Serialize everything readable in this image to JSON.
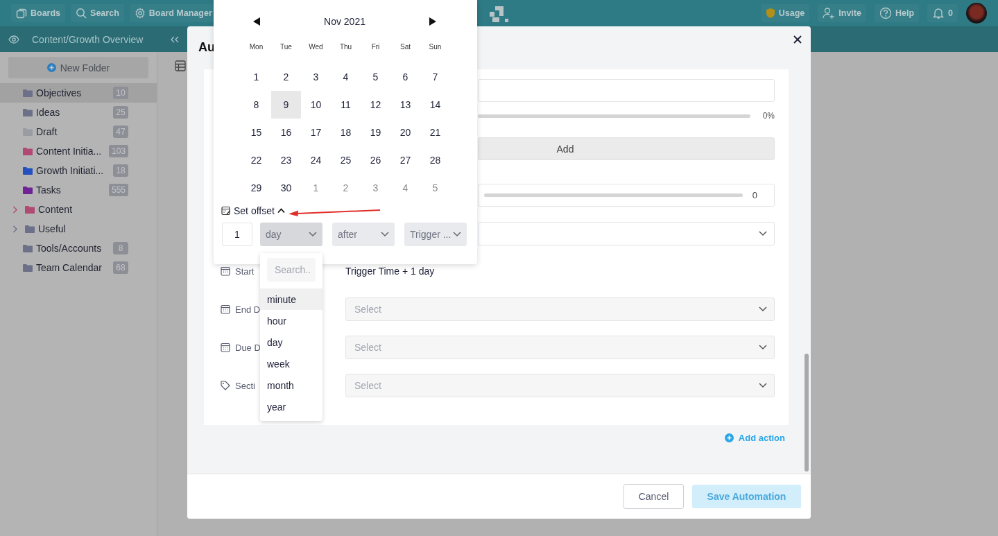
{
  "topbar": {
    "buttons": [
      {
        "kind": "boards",
        "label": "Boards"
      },
      {
        "kind": "search",
        "label": "Search"
      },
      {
        "kind": "settings",
        "label": "Board Manager"
      }
    ],
    "right": [
      {
        "kind": "usage",
        "label": "Usage"
      },
      {
        "kind": "invite",
        "label": "Invite"
      },
      {
        "kind": "help",
        "label": "Help"
      },
      {
        "kind": "notifications",
        "label": "0"
      }
    ]
  },
  "board_bar": {
    "title": "Content/Growth Overview"
  },
  "sidebar": {
    "new_folder": "New Folder",
    "items": [
      {
        "label": "Objectives",
        "count": "10",
        "color": "#6c7088",
        "selected": true,
        "expandable": false
      },
      {
        "label": "Ideas",
        "count": "25",
        "color": "#6c7088",
        "selected": false,
        "expandable": false
      },
      {
        "label": "Draft",
        "count": "47",
        "color": "#9a9ca4",
        "selected": false,
        "expandable": false
      },
      {
        "label": "Content Initia...",
        "count": "103",
        "color": "#b04a72",
        "selected": false,
        "expandable": false
      },
      {
        "label": "Growth Initiati...",
        "count": "18",
        "color": "#2450c0",
        "selected": false,
        "expandable": false
      },
      {
        "label": "Tasks",
        "count": "555",
        "color": "#6e2494",
        "selected": false,
        "expandable": false
      },
      {
        "label": "Content",
        "color": "#b04a72",
        "selected": false,
        "expandable": true,
        "expanded": false
      },
      {
        "label": "Useful",
        "color": "#6c7088",
        "selected": false,
        "expandable": true,
        "expanded": false
      },
      {
        "label": "Tools/Accounts",
        "count": "8",
        "color": "#6c7088",
        "selected": false,
        "expandable": false
      },
      {
        "label": "Team Calendar",
        "count": "68",
        "color": "#6c7088",
        "selected": false,
        "expandable": false
      }
    ]
  },
  "modal": {
    "title": "Au",
    "progress": {
      "level": 0,
      "reading": "0%"
    },
    "add_button": "Add",
    "slider": {
      "reading": "0"
    },
    "fields": [
      {
        "kind": "date_value",
        "label": "Start",
        "value": "Trigger Time + 1 day"
      },
      {
        "kind": "date_select",
        "label": "End D",
        "placeholder": "Select"
      },
      {
        "kind": "date_select",
        "label": "Due D",
        "placeholder": "Select"
      },
      {
        "kind": "tag_select",
        "label": "Secti",
        "placeholder": "Select"
      }
    ],
    "add_action": "Add action",
    "cancel": "Cancel",
    "save": {
      "label": "Save Automation",
      "disabled": true
    }
  },
  "calendar": {
    "month": "Nov 2021",
    "weekdays": [
      "Mon",
      "Tue",
      "Wed",
      "Thu",
      "Fri",
      "Sat",
      "Sun"
    ],
    "days": [
      {
        "label": "1",
        "outside": false,
        "selected": false
      },
      {
        "label": "2",
        "outside": false,
        "selected": false
      },
      {
        "label": "3",
        "outside": false,
        "selected": false
      },
      {
        "label": "4",
        "outside": false,
        "selected": false
      },
      {
        "label": "5",
        "outside": false,
        "selected": false
      },
      {
        "label": "6",
        "outside": false,
        "selected": false
      },
      {
        "label": "7",
        "outside": false,
        "selected": false
      },
      {
        "label": "8",
        "outside": false,
        "selected": false
      },
      {
        "label": "9",
        "outside": false,
        "selected": true
      },
      {
        "label": "10",
        "outside": false,
        "selected": false
      },
      {
        "label": "11",
        "outside": false,
        "selected": false
      },
      {
        "label": "12",
        "outside": false,
        "selected": false
      },
      {
        "label": "13",
        "outside": false,
        "selected": false
      },
      {
        "label": "14",
        "outside": false,
        "selected": false
      },
      {
        "label": "15",
        "outside": false,
        "selected": false
      },
      {
        "label": "16",
        "outside": false,
        "selected": false
      },
      {
        "label": "17",
        "outside": false,
        "selected": false
      },
      {
        "label": "18",
        "outside": false,
        "selected": false
      },
      {
        "label": "19",
        "outside": false,
        "selected": false
      },
      {
        "label": "20",
        "outside": false,
        "selected": false
      },
      {
        "label": "21",
        "outside": false,
        "selected": false
      },
      {
        "label": "22",
        "outside": false,
        "selected": false
      },
      {
        "label": "23",
        "outside": false,
        "selected": false
      },
      {
        "label": "24",
        "outside": false,
        "selected": false
      },
      {
        "label": "25",
        "outside": false,
        "selected": false
      },
      {
        "label": "26",
        "outside": false,
        "selected": false
      },
      {
        "label": "27",
        "outside": false,
        "selected": false
      },
      {
        "label": "28",
        "outside": false,
        "selected": false
      },
      {
        "label": "29",
        "outside": false,
        "selected": false
      },
      {
        "label": "30",
        "outside": false,
        "selected": false
      },
      {
        "label": "1",
        "outside": true,
        "selected": false
      },
      {
        "label": "2",
        "outside": true,
        "selected": false
      },
      {
        "label": "3",
        "outside": true,
        "selected": false
      },
      {
        "label": "4",
        "outside": true,
        "selected": false
      },
      {
        "label": "5",
        "outside": true,
        "selected": false
      }
    ],
    "offset": {
      "label": "Set offset",
      "expanded": true,
      "amount": "1",
      "selects": [
        {
          "value": "day",
          "open": true
        },
        {
          "value": "after",
          "open": false
        },
        {
          "value": "Trigger ...",
          "open": false
        }
      ],
      "dropdown": {
        "search_placeholder": "Search..",
        "options": [
          {
            "label": "minute",
            "highlighted": true
          },
          {
            "label": "hour",
            "highlighted": false
          },
          {
            "label": "day",
            "highlighted": false
          },
          {
            "label": "week",
            "highlighted": false
          },
          {
            "label": "month",
            "highlighted": false
          },
          {
            "label": "year",
            "highlighted": false
          }
        ]
      }
    }
  }
}
